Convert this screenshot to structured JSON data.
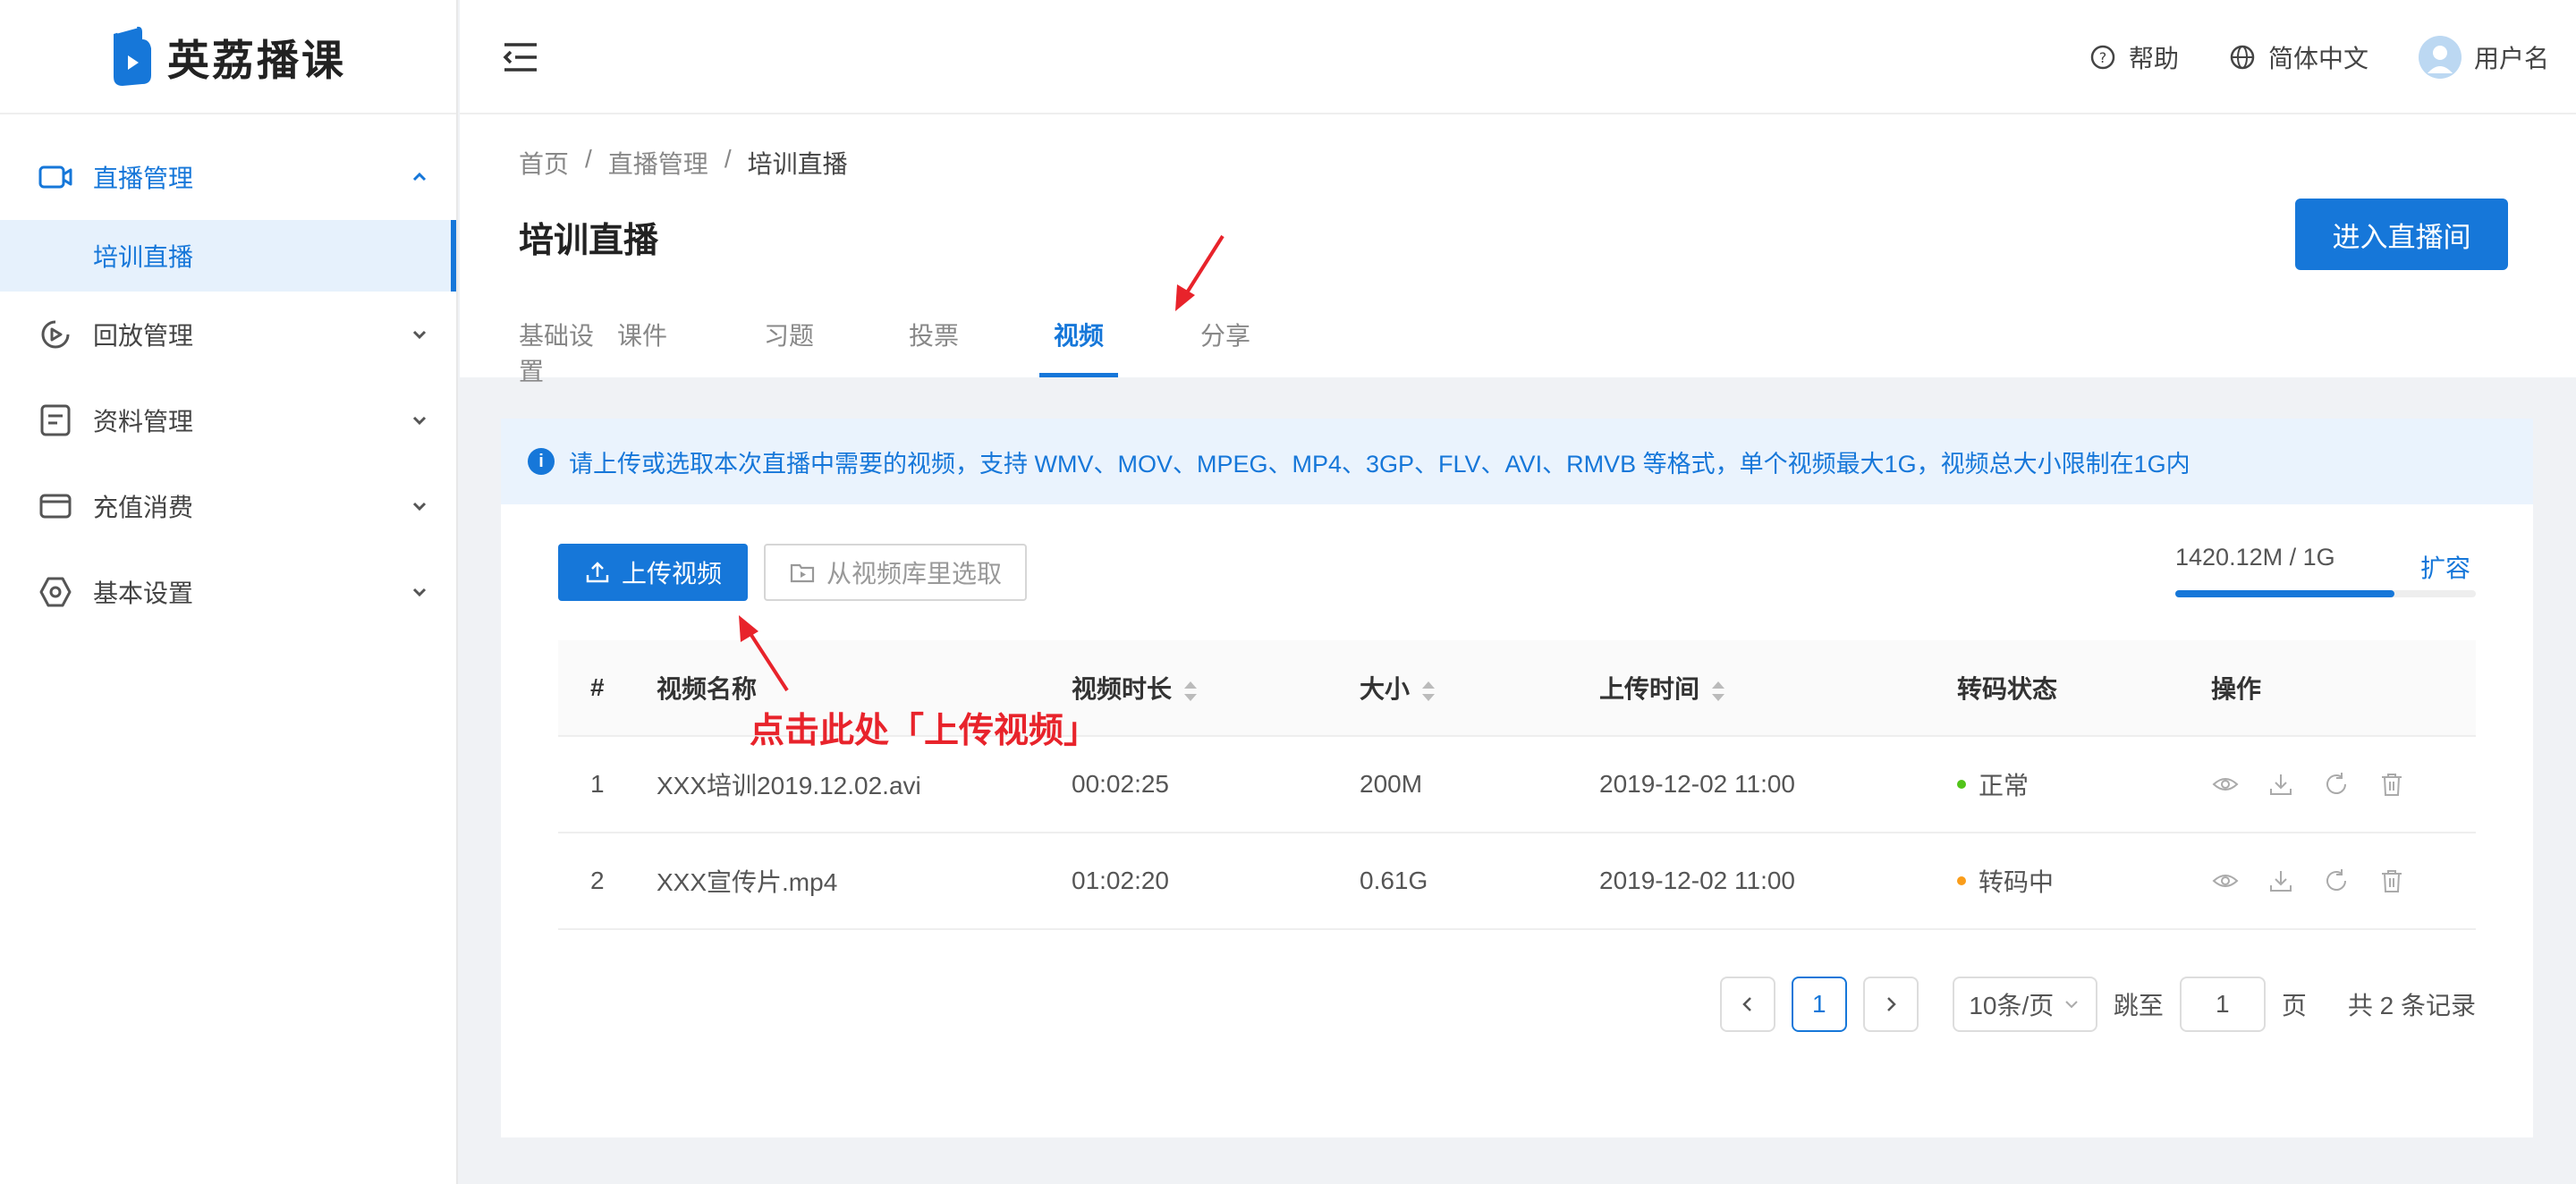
{
  "app": {
    "name": "英荔播课"
  },
  "header": {
    "help": "帮助",
    "language": "简体中文",
    "username": "用户名"
  },
  "sidebar": {
    "items": [
      {
        "label": "直播管理",
        "icon": "video-camera-icon",
        "expanded": true,
        "children": [
          {
            "label": "培训直播",
            "active": true
          }
        ]
      },
      {
        "label": "回放管理",
        "icon": "replay-icon"
      },
      {
        "label": "资料管理",
        "icon": "document-icon"
      },
      {
        "label": "充值消费",
        "icon": "wallet-icon"
      },
      {
        "label": "基本设置",
        "icon": "settings-hexagon-icon"
      }
    ]
  },
  "breadcrumb": {
    "items": [
      "首页",
      "直播管理",
      "培训直播"
    ],
    "separator": "/"
  },
  "page": {
    "title": "培训直播",
    "enter_button": "进入直播间"
  },
  "tabs": [
    {
      "label": "基础设置"
    },
    {
      "label": "课件"
    },
    {
      "label": "习题"
    },
    {
      "label": "投票"
    },
    {
      "label": "视频",
      "active": true
    },
    {
      "label": "分享"
    }
  ],
  "notice": {
    "text": "请上传或选取本次直播中需要的视频，支持 WMV、MOV、MPEG、MP4、3GP、FLV、AVI、RMVB 等格式，单个视频最大1G，视频总大小限制在1G内"
  },
  "toolbar": {
    "upload": "上传视频",
    "library": "从视频库里选取"
  },
  "storage": {
    "text": "1420.12M / 1G",
    "fill_percent": 73,
    "expand": "扩容"
  },
  "table": {
    "columns": [
      "#",
      "视频名称",
      "视频时长",
      "大小",
      "上传时间",
      "转码状态",
      "操作"
    ],
    "rows": [
      {
        "index": "1",
        "name": "XXX培训2019.12.02.avi",
        "duration": "00:02:25",
        "size": "200M",
        "uploaded": "2019-12-02 11:00",
        "status": "正常",
        "status_color": "#52c41a"
      },
      {
        "index": "2",
        "name": "XXX宣传片.mp4",
        "duration": "01:02:20",
        "size": "0.61G",
        "uploaded": "2019-12-02 11:00",
        "status": "转码中",
        "status_color": "#fa9d1a"
      }
    ]
  },
  "pagination": {
    "current": "1",
    "page_size": "10条/页",
    "jump_label": "跳至",
    "jump_value": "1",
    "page_unit": "页",
    "total": "共 2 条记录"
  },
  "annotation": {
    "text": "点击此处「上传视频」",
    "color": "#e8232b"
  },
  "colors": {
    "primary": "#1677d9",
    "alert_bg": "#eaf3fd"
  }
}
